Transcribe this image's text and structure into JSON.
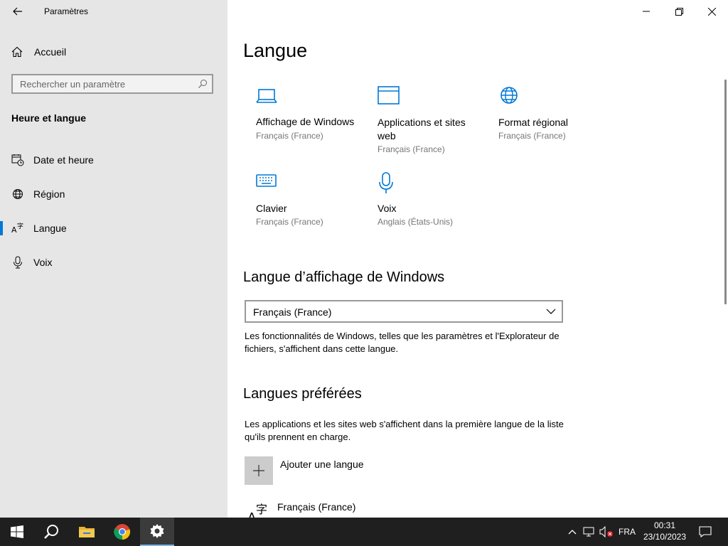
{
  "window": {
    "title": "Paramètres",
    "controls": {
      "minimize": "minimize-icon",
      "maximize": "restore-icon",
      "close": "close-icon"
    }
  },
  "sidebar": {
    "home_label": "Accueil",
    "search_placeholder": "Rechercher un paramètre",
    "section_title": "Heure et langue",
    "items": [
      {
        "label": "Date et heure",
        "icon": "calendar-clock-icon",
        "active": false
      },
      {
        "label": "Région",
        "icon": "globe-icon",
        "active": false
      },
      {
        "label": "Langue",
        "icon": "language-icon",
        "active": true
      },
      {
        "label": "Voix",
        "icon": "microphone-icon",
        "active": false
      }
    ]
  },
  "main": {
    "title": "Langue",
    "tiles": [
      {
        "name": "Affichage de Windows",
        "sub": "Français (France)",
        "icon": "laptop-icon"
      },
      {
        "name": "Applications et sites web",
        "sub": "Français (France)",
        "icon": "window-icon"
      },
      {
        "name": "Format régional",
        "sub": "Français (France)",
        "icon": "globe-icon"
      },
      {
        "name": "Clavier",
        "sub": "Français (France)",
        "icon": "keyboard-icon"
      },
      {
        "name": "Voix",
        "sub": "Anglais (États-Unis)",
        "icon": "microphone-icon"
      }
    ],
    "display_language": {
      "heading": "Langue d’affichage de Windows",
      "selected": "Français (France)",
      "description": "Les fonctionnalités de Windows, telles que les paramètres et l'Explorateur de fichiers, s'affichent dans cette langue."
    },
    "preferred": {
      "heading": "Langues préférées",
      "description": "Les applications et les sites web s'affichent dans la première langue de la liste qu'ils prennent en charge.",
      "add_label": "Ajouter une langue",
      "languages": [
        "Français (France)"
      ]
    }
  },
  "taskbar": {
    "apps": [
      "windows-start-icon",
      "search-icon",
      "file-explorer-icon",
      "chrome-icon",
      "settings-icon"
    ],
    "language_indicator": "FRA",
    "time": "00:31",
    "date": "23/10/2023"
  },
  "colors": {
    "accent": "#0078d7",
    "sidebar_bg": "#e6e6e6",
    "taskbar_bg": "#1f1f1f"
  }
}
